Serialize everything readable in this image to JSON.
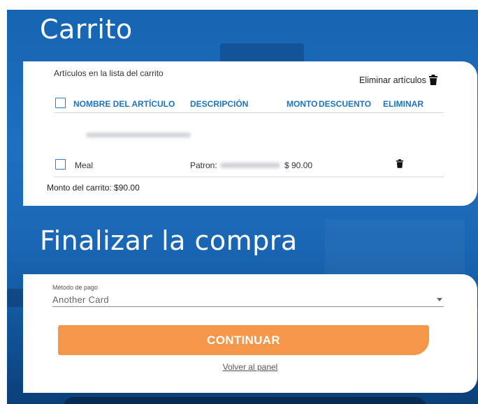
{
  "cart": {
    "title": "Carrito",
    "caption": "Artículos en la lista del carrito",
    "remove_items_label": "Eliminar artículos",
    "columns": [
      "NOMBRE DEL ARTÍCULO",
      "DESCRIPCIÓN",
      "MONTO",
      "DESCUENTO",
      "ELIMINAR"
    ],
    "items": [
      {
        "name": "Meal",
        "description": "Patron:",
        "amount": "$ 90.00"
      }
    ],
    "total": "Monto del carrito: $90.00"
  },
  "checkout": {
    "title": "Finalizar la compra",
    "payment_label": "Método de pago",
    "payment_value": "Another Card",
    "continue_label": "CONTINUAR",
    "back_label": "Volver al panel"
  },
  "colors": {
    "accent": "#1a74c2",
    "button": "#f5974a",
    "background": "#1565b3"
  }
}
